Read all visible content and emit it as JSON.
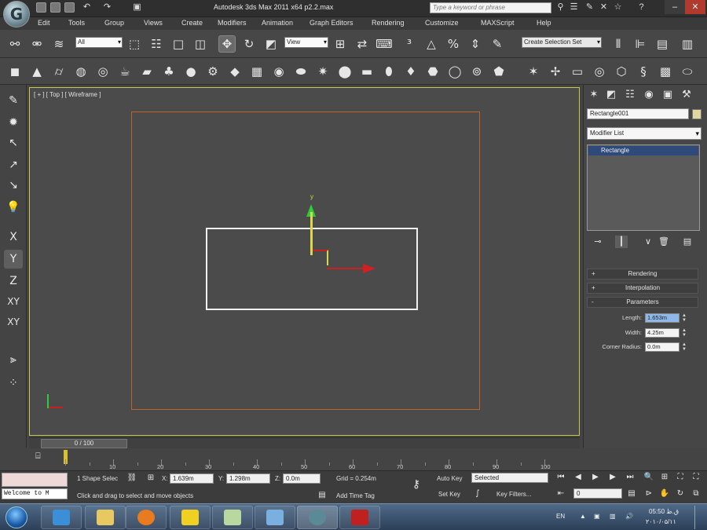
{
  "title": "Autodesk 3ds Max  2011 x64      p2.2.max",
  "search_placeholder": "Type a keyword or phrase",
  "menus": [
    "Edit",
    "Tools",
    "Group",
    "Views",
    "Create",
    "Modifiers",
    "Animation",
    "Graph Editors",
    "Rendering",
    "Customize",
    "MAXScript",
    "Help"
  ],
  "toolbar": {
    "selection_filter": "All",
    "ref_coord": "View",
    "named_selection": "Create Selection Set"
  },
  "viewport": {
    "label": "[ + ] [ Top ] [ Wireframe ]",
    "gizmo_y_label": "y"
  },
  "command_panel": {
    "object_name": "Rectangle001",
    "object_color": "#e0d8a0",
    "modifier_list": "Modifier List",
    "stack_item": "Rectangle",
    "rollouts": [
      {
        "sign": "+",
        "label": "Rendering"
      },
      {
        "sign": "+",
        "label": "Interpolation"
      },
      {
        "sign": "-",
        "label": "Parameters"
      }
    ],
    "params": [
      {
        "label": "Length:",
        "value": "1.653m"
      },
      {
        "label": "Width:",
        "value": "4.25m"
      },
      {
        "label": "Corner Radius:",
        "value": "0.0m"
      }
    ]
  },
  "timeline": {
    "slider": "0 / 100",
    "ticks": [
      "10",
      "20",
      "30",
      "40",
      "50",
      "60",
      "70",
      "80",
      "90",
      "100"
    ]
  },
  "status": {
    "listener": "Welcome to M",
    "selection": "1 Shape Selec",
    "x_label": "X:",
    "x": "1.639m",
    "y_label": "Y:",
    "y": "1.298m",
    "z_label": "Z:",
    "z": "0.0m",
    "grid": "Grid = 0.254m",
    "prompt": "Click and drag to select and move objects",
    "add_time_tag": "Add Time Tag",
    "auto_key": "Auto Key",
    "key_mode": "Selected",
    "set_key": "Set Key",
    "key_filters": "Key Filters...",
    "frame": "0"
  },
  "taskbar": {
    "lang": "EN",
    "time": "05:50 ق.ظ",
    "date": "۲۰۱۰/۰۵/۱۱"
  }
}
